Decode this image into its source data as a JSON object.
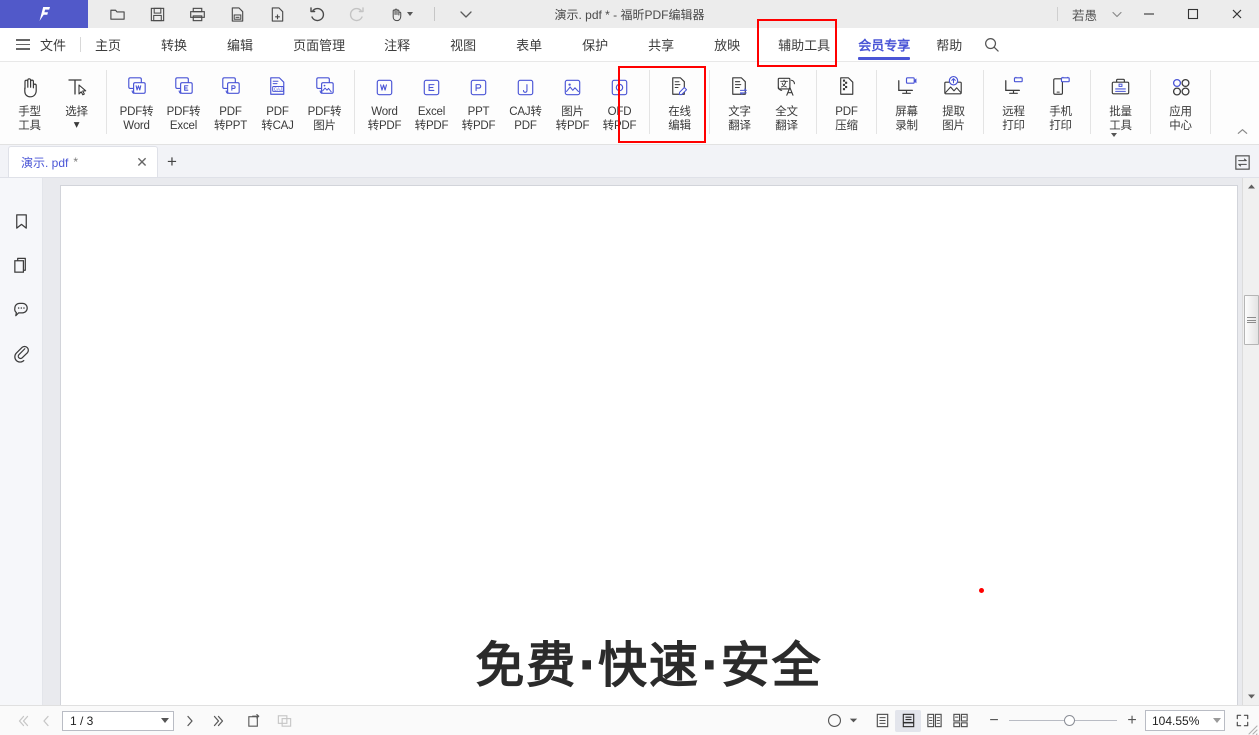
{
  "app": {
    "title": "演示. pdf * - 福昕PDF编辑器",
    "logo_icon": "foxit-f-logo",
    "brand_color": "#5159c9",
    "accent_color": "#4a55d6",
    "highlight_color": "#ff0000"
  },
  "titlebar": {
    "quick_access": [
      {
        "name": "open-icon",
        "label": "打开"
      },
      {
        "name": "save-icon",
        "label": "保存"
      },
      {
        "name": "print-icon",
        "label": "打印"
      },
      {
        "name": "save-as-icon",
        "label": "另存为"
      },
      {
        "name": "new-file-icon",
        "label": "新建"
      },
      {
        "name": "undo-icon",
        "label": "撤销"
      },
      {
        "name": "redo-icon",
        "label": "重做"
      },
      {
        "name": "hand-tool-icon",
        "label": "手型工具"
      }
    ],
    "more_icon": "chevron-down-icon",
    "user": "若愚",
    "user_caret_icon": "chevron-down-icon",
    "minimize_icon": "minimize-icon",
    "maximize_icon": "maximize-icon",
    "close_icon": "close-icon"
  },
  "menubar": {
    "menu_icon": "hamburger-icon",
    "items": [
      {
        "label": "文件",
        "active": false
      },
      {
        "label": "主页",
        "active": false
      },
      {
        "label": "转换",
        "active": false
      },
      {
        "label": "编辑",
        "active": false
      },
      {
        "label": "页面管理",
        "active": false
      },
      {
        "label": "注释",
        "active": false
      },
      {
        "label": "视图",
        "active": false
      },
      {
        "label": "表单",
        "active": false
      },
      {
        "label": "保护",
        "active": false
      },
      {
        "label": "共享",
        "active": false
      },
      {
        "label": "放映",
        "active": false
      },
      {
        "label": "辅助工具",
        "active": false
      },
      {
        "label": "会员专享",
        "active": true
      },
      {
        "label": "帮助",
        "active": false
      }
    ],
    "search_icon": "search-icon"
  },
  "ribbon": {
    "groups": [
      {
        "buttons": [
          {
            "icon": "hand-tool-icon",
            "line1": "手型",
            "line2": "工具",
            "caret": false
          },
          {
            "icon": "select-text-icon",
            "line1": "选择",
            "line2": "",
            "caret": true
          }
        ]
      },
      {
        "buttons": [
          {
            "icon": "pdf-to-word-icon",
            "line1": "PDF转",
            "line2": "Word",
            "caret": false
          },
          {
            "icon": "pdf-to-excel-icon",
            "line1": "PDF转",
            "line2": "Excel",
            "caret": false
          },
          {
            "icon": "pdf-to-ppt-icon",
            "line1": "PDF",
            "line2": "转PPT",
            "caret": false
          },
          {
            "icon": "pdf-to-caj-icon",
            "line1": "PDF",
            "line2": "转CAJ",
            "caret": false
          },
          {
            "icon": "pdf-to-image-icon",
            "line1": "PDF转",
            "line2": "图片",
            "caret": false
          }
        ]
      },
      {
        "buttons": [
          {
            "icon": "word-to-pdf-icon",
            "line1": "Word",
            "line2": "转PDF",
            "caret": false
          },
          {
            "icon": "excel-to-pdf-icon",
            "line1": "Excel",
            "line2": "转PDF",
            "caret": false
          },
          {
            "icon": "ppt-to-pdf-icon",
            "line1": "PPT",
            "line2": "转PDF",
            "caret": false
          },
          {
            "icon": "caj-to-pdf-icon",
            "line1": "CAJ转",
            "line2": "PDF",
            "caret": false
          },
          {
            "icon": "image-to-pdf-icon",
            "line1": "图片",
            "line2": "转PDF",
            "caret": false
          },
          {
            "icon": "ofd-to-pdf-icon",
            "line1": "OFD",
            "line2": "转PDF",
            "caret": false
          }
        ]
      },
      {
        "buttons": [
          {
            "icon": "online-edit-icon",
            "line1": "在线",
            "line2": "编辑",
            "caret": false
          }
        ]
      },
      {
        "highlighted": true,
        "buttons": [
          {
            "icon": "text-translate-icon",
            "line1": "文字",
            "line2": "翻译",
            "caret": false
          },
          {
            "icon": "full-translate-icon",
            "line1": "全文",
            "line2": "翻译",
            "caret": false
          }
        ]
      },
      {
        "buttons": [
          {
            "icon": "pdf-compress-icon",
            "line1": "PDF",
            "line2": "压缩",
            "caret": false
          }
        ]
      },
      {
        "buttons": [
          {
            "icon": "screen-record-icon",
            "line1": "屏幕",
            "line2": "录制",
            "caret": false
          },
          {
            "icon": "extract-image-icon",
            "line1": "提取",
            "line2": "图片",
            "caret": false
          }
        ]
      },
      {
        "buttons": [
          {
            "icon": "remote-print-icon",
            "line1": "远程",
            "line2": "打印",
            "caret": false
          },
          {
            "icon": "mobile-print-icon",
            "line1": "手机",
            "line2": "打印",
            "caret": false
          }
        ]
      },
      {
        "buttons": [
          {
            "icon": "batch-tools-icon",
            "line1": "批量",
            "line2": "工具",
            "caret": true
          }
        ]
      },
      {
        "buttons": [
          {
            "icon": "app-center-icon",
            "line1": "应用",
            "line2": "中心",
            "caret": false
          }
        ]
      }
    ],
    "collapse_icon": "chevron-up-icon"
  },
  "doctabs": {
    "tabs": [
      {
        "name": "演示. pdf",
        "modified_mark": "*",
        "close_icon": "close-icon"
      }
    ],
    "new_tab_icon": "plus-icon",
    "right_panel_icon": "compare-icon"
  },
  "leftrail": {
    "items": [
      {
        "icon": "bookmark-icon",
        "label": "书签"
      },
      {
        "icon": "pages-icon",
        "label": "页面缩略图"
      },
      {
        "icon": "comments-icon",
        "label": "注释"
      },
      {
        "icon": "attachments-icon",
        "label": "附件"
      }
    ],
    "expand_icon": "expand-arrow-icon"
  },
  "document": {
    "page_heading": "免费·快速·安全",
    "cursor_marker": "red-dot"
  },
  "scrollbar": {
    "up_icon": "scroll-up-arrow-icon",
    "down_icon": "scroll-down-arrow-icon",
    "thumb": "scroll-thumb"
  },
  "statusbar": {
    "first_page_icon": "first-page-icon",
    "prev_page_icon": "prev-page-icon",
    "page_value": "1 / 3",
    "page_dropdown_icon": "chevron-down-icon",
    "next_page_icon": "next-page-icon",
    "last_page_icon": "last-page-icon",
    "rotate_icon": "rotate-page-icon",
    "copy_page_icon": "duplicate-page-icon",
    "read_mode_icon": "read-mode-icon",
    "read_mode_caret_icon": "chevron-down-icon",
    "view_modes": [
      {
        "icon": "single-page-view-icon",
        "selected": false
      },
      {
        "icon": "continuous-view-icon",
        "selected": true
      },
      {
        "icon": "two-page-view-icon",
        "selected": false
      },
      {
        "icon": "two-page-continuous-icon",
        "selected": false
      }
    ],
    "zoom_out_label": "−",
    "zoom_in_label": "+",
    "zoom_value": "104.55%",
    "zoom_dropdown_icon": "chevron-down-icon",
    "fullscreen_icon": "fullscreen-icon",
    "resize-grip": "resize-grip-icon"
  }
}
